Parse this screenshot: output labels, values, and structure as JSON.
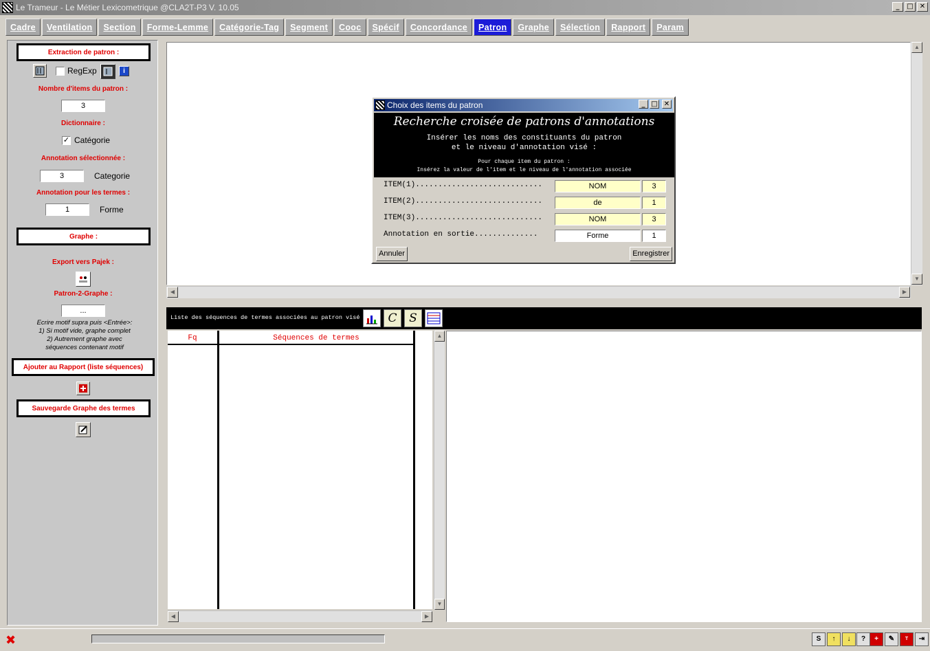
{
  "window": {
    "title": "Le Trameur - Le Métier Lexicometrique @CLA2T-P3 V. 10.05",
    "minimize": "_",
    "maximize": "□",
    "close": "✕"
  },
  "tabs": [
    {
      "label": "Cadre"
    },
    {
      "label": "Ventilation"
    },
    {
      "label": "Section"
    },
    {
      "label": "Forme-Lemme"
    },
    {
      "label": "Catégorie-Tag"
    },
    {
      "label": "Segment"
    },
    {
      "label": "Cooc"
    },
    {
      "label": "Spécif"
    },
    {
      "label": "Concordance"
    },
    {
      "label": "Patron"
    },
    {
      "label": "Graphe"
    },
    {
      "label": "Sélection"
    },
    {
      "label": "Rapport"
    },
    {
      "label": "Param"
    }
  ],
  "active_tab": "Patron",
  "left_panel": {
    "extraction_header": "Extraction de patron :",
    "regexp_label": "RegExp",
    "regexp_checked": false,
    "nb_items_label": "Nombre d'items du patron :",
    "nb_items_value": "3",
    "dictionnaire_label": "Dictionnaire :",
    "categorie_check_label": "Catégorie",
    "categorie_checked": true,
    "annotation_sel_label": "Annotation sélectionnée :",
    "annotation_sel_value": "3",
    "annotation_sel_name": "Categorie",
    "annotation_termes_label": "Annotation pour les termes :",
    "annotation_termes_value": "1",
    "annotation_termes_name": "Forme",
    "graphe_header": "Graphe :",
    "export_pajek_label": "Export vers Pajek :",
    "patron2graphe_label": "Patron-2-Graphe :",
    "patron2graphe_value": "...",
    "note_lines": [
      "Ecrire motif supra puis <Entrée>:",
      "1) Si motif vide, graphe complet",
      "2)  Autrement graphe avec",
      "séquences contenant motif"
    ],
    "ajouter_rapport_header": "Ajouter au Rapport (liste séquences)",
    "sauvegarde_header": "Sauvegarde Graphe des termes"
  },
  "dialog": {
    "title": "Choix des items du patron",
    "heading": "Recherche croisée de patrons d'annotations",
    "instruction_1": "Insérer les noms des constituants du patron",
    "instruction_2": "et le niveau d'annotation visé :",
    "small_1": "Pour chaque item du patron :",
    "small_2": "Insérez la valeur de l'item et le niveau de l'annotation associée",
    "items": [
      {
        "label": "ITEM(1)............................",
        "value": "NOM",
        "level": "3"
      },
      {
        "label": "ITEM(2)............................",
        "value": "de",
        "level": "1"
      },
      {
        "label": "ITEM(3)............................",
        "value": "NOM",
        "level": "3"
      }
    ],
    "output": {
      "label": "Annotation en sortie..............",
      "value": "Forme",
      "level": "1"
    },
    "cancel_label": "Annuler",
    "save_label": "Enregistrer"
  },
  "list_panel": {
    "toolbar_label": "Liste des séquences de termes associées au patron visé",
    "col_fq": "Fq",
    "col_sequences": "Séquences de termes"
  },
  "colors": {
    "active_tab": "#1c1cd8",
    "label_red": "#e00000",
    "field_yellow": "#ffffc8"
  }
}
